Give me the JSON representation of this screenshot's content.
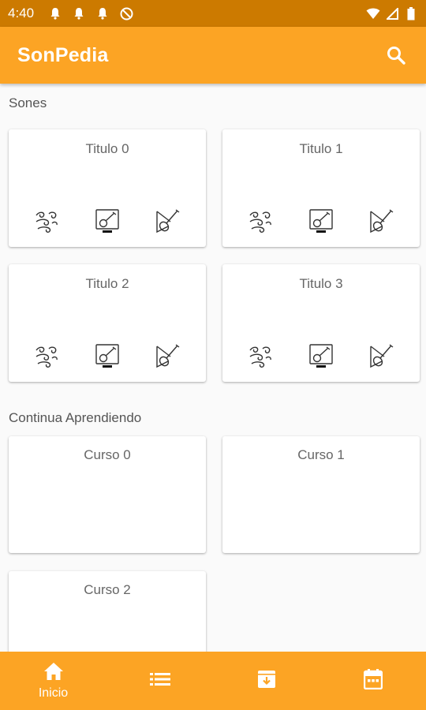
{
  "status_bar": {
    "time": "4:40",
    "left_icons": [
      "notification-bell-icon",
      "notification-bell-icon",
      "notification-bell-icon",
      "no-data-icon"
    ],
    "right_icons": [
      "wifi-icon",
      "signal-icon",
      "battery-icon"
    ]
  },
  "app_bar": {
    "title": "SonPedia",
    "search_icon": "search-icon",
    "color": "#fca424"
  },
  "sones": {
    "label": "Sones",
    "cards": [
      {
        "title": "Titulo 0",
        "icons": [
          "wind-swirl-icon",
          "guitar-tablet-icon",
          "violin-icon"
        ]
      },
      {
        "title": "Titulo 1",
        "icons": [
          "wind-swirl-icon",
          "guitar-tablet-icon",
          "violin-icon"
        ]
      },
      {
        "title": "Titulo 2",
        "icons": [
          "wind-swirl-icon",
          "guitar-tablet-icon",
          "violin-icon"
        ]
      },
      {
        "title": "Titulo 3",
        "icons": [
          "wind-swirl-icon",
          "guitar-tablet-icon",
          "violin-icon"
        ]
      }
    ]
  },
  "continua": {
    "label": "Continua Aprendiendo",
    "cards": [
      {
        "title": "Curso 0"
      },
      {
        "title": "Curso 1"
      },
      {
        "title": "Curso 2"
      }
    ]
  },
  "bottom_nav": {
    "color": "#fca424",
    "items": [
      {
        "icon": "home-icon",
        "label": "Inicio",
        "active": true
      },
      {
        "icon": "list-icon",
        "label": ""
      },
      {
        "icon": "archive-box-icon",
        "label": ""
      },
      {
        "icon": "calendar-icon",
        "label": ""
      }
    ]
  }
}
